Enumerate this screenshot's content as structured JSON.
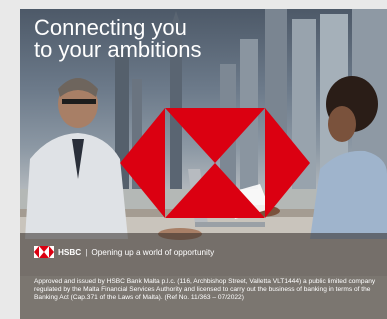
{
  "headline": {
    "line1": "Connecting you",
    "line2": "to your ambitions"
  },
  "brand": {
    "name": "HSBC",
    "tagline": "Opening up a world of opportunity",
    "separator": "|"
  },
  "legal_text": "Approved and issued by HSBC Bank Malta p.l.c. (116, Archbishop Street, Valletta VLT1444) a public limited company regulated by the Malta Financial Services Authority and licensed to carry out the business of banking in terms of the Banking Act (Cap.371 of the Laws of Malta). (Ref No. 11/363 – 07/2022)",
  "colors": {
    "hsbc_red": "#db0011",
    "white": "#ffffff"
  }
}
